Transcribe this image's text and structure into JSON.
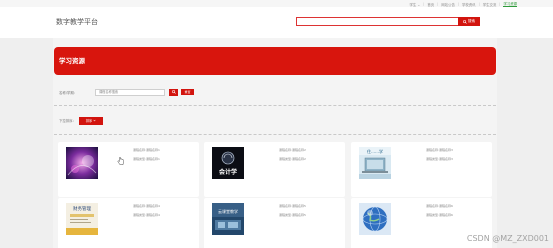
{
  "topnav": {
    "links": [
      {
        "label": "学生 ⌄",
        "active": false
      },
      {
        "label": "首页",
        "active": false
      },
      {
        "label": "网站公告",
        "active": false
      },
      {
        "label": "学校资讯",
        "active": false
      },
      {
        "label": "学生交流",
        "active": false
      },
      {
        "label": "学习资源",
        "active": true
      }
    ]
  },
  "header": {
    "brand": "数字教学平台",
    "search_placeholder": "",
    "search_button": "搜索",
    "search_icon": "search-icon"
  },
  "banner": {
    "title": "学习资源"
  },
  "filter": {
    "label": "名称/学期：",
    "input_placeholder": "课程名称搜索",
    "search_icon": "search-icon",
    "reset_button": "重置"
  },
  "sort": {
    "label": "下拉排序：",
    "button": "排序",
    "button_icon": "chevron-down-icon"
  },
  "cards": [
    {
      "thumb": "thumb-purple-abstract",
      "lines": [
        "课程名称:课程名称1",
        "课程类型:课程名称1"
      ]
    },
    {
      "thumb": "thumb-accounting",
      "thumb_text": "会计学",
      "lines": [
        "课程名称:课程名称2",
        "课程类型:课程名称2"
      ]
    },
    {
      "thumb": "thumb-laptop",
      "thumb_text": "住……学",
      "lines": [
        "课程名称:课程名称3",
        "课程类型:课程名称3"
      ]
    },
    {
      "thumb": "thumb-book",
      "thumb_text": "财务管理",
      "lines": [
        "课程名称:课程名称4",
        "课程类型:课程名称4"
      ]
    },
    {
      "thumb": "thumb-classroom",
      "thumb_text": "云课堂教学",
      "lines": [
        "课程名称:课程名称5",
        "课程类型:课程名称5"
      ]
    },
    {
      "thumb": "thumb-globe",
      "lines": [
        "课程名称:课程名称6",
        "课程类型:课程名称6"
      ]
    }
  ],
  "watermark": "CSDN @MZ_ZXD001",
  "colors": {
    "accent": "#d2140e",
    "active_nav": "#2e9a3a",
    "background": "#efefef"
  }
}
